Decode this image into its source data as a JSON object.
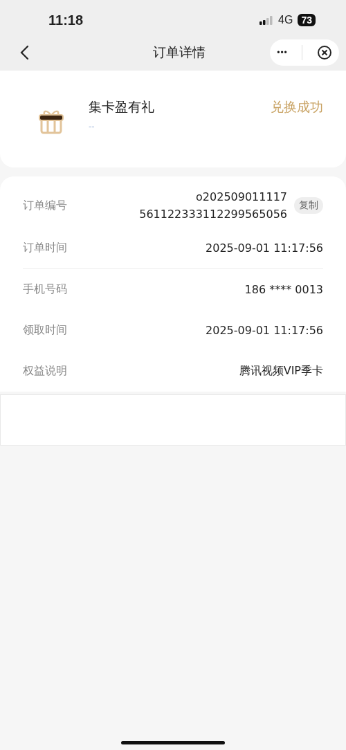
{
  "status_bar": {
    "time": "11:18",
    "network": "4G",
    "battery": "73"
  },
  "nav": {
    "title": "订单详情",
    "more": "•••"
  },
  "product": {
    "name": "集卡盈有礼",
    "subtitle": "--",
    "status": "兑换成功"
  },
  "details": [
    {
      "kind": "order_no",
      "label": "订单编号",
      "lines": [
        "o202509011117",
        "561122333112299565056"
      ],
      "action": "复制",
      "divider_after": false
    },
    {
      "kind": "text",
      "label": "订单时间",
      "value": "2025-09-01 11:17:56",
      "divider_after": true
    },
    {
      "kind": "text",
      "label": "手机号码",
      "value": "186 **** 0013",
      "divider_after": false
    },
    {
      "kind": "text",
      "label": "领取时间",
      "value": "2025-09-01 11:17:56",
      "divider_after": false
    },
    {
      "kind": "text",
      "label": "权益说明",
      "value": "腾讯视频VIP季卡",
      "divider_after": false
    }
  ]
}
